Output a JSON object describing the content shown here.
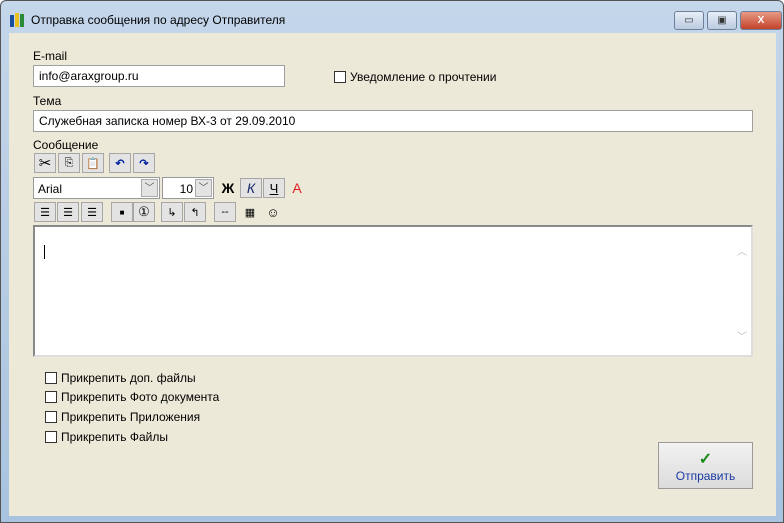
{
  "window": {
    "title": "Отправка сообщения по адресу Отправителя",
    "minimize": "▭",
    "maximize": "▣",
    "close": "X"
  },
  "form": {
    "email_label": "E-mail",
    "email_value": "info@araxgroup.ru",
    "read_receipt_label": "Уведомление о прочтении",
    "subject_label": "Тема",
    "subject_value": "Служебная записка номер ВХ-3 от 29.09.2010",
    "message_label": "Сообщение",
    "font_value": "Arial",
    "size_value": "10",
    "bold": "Ж",
    "italic": "К",
    "underline": "Ч",
    "color": "A",
    "bullet": "■",
    "numbering": "①",
    "separator": "--",
    "smiley": "☺",
    "attachments": [
      "Прикрепить доп. файлы",
      "Прикрепить Фото документа",
      "Прикрепить Приложения",
      "Прикрепить Файлы"
    ],
    "send_label": "Отправить",
    "send_check": "✓"
  }
}
